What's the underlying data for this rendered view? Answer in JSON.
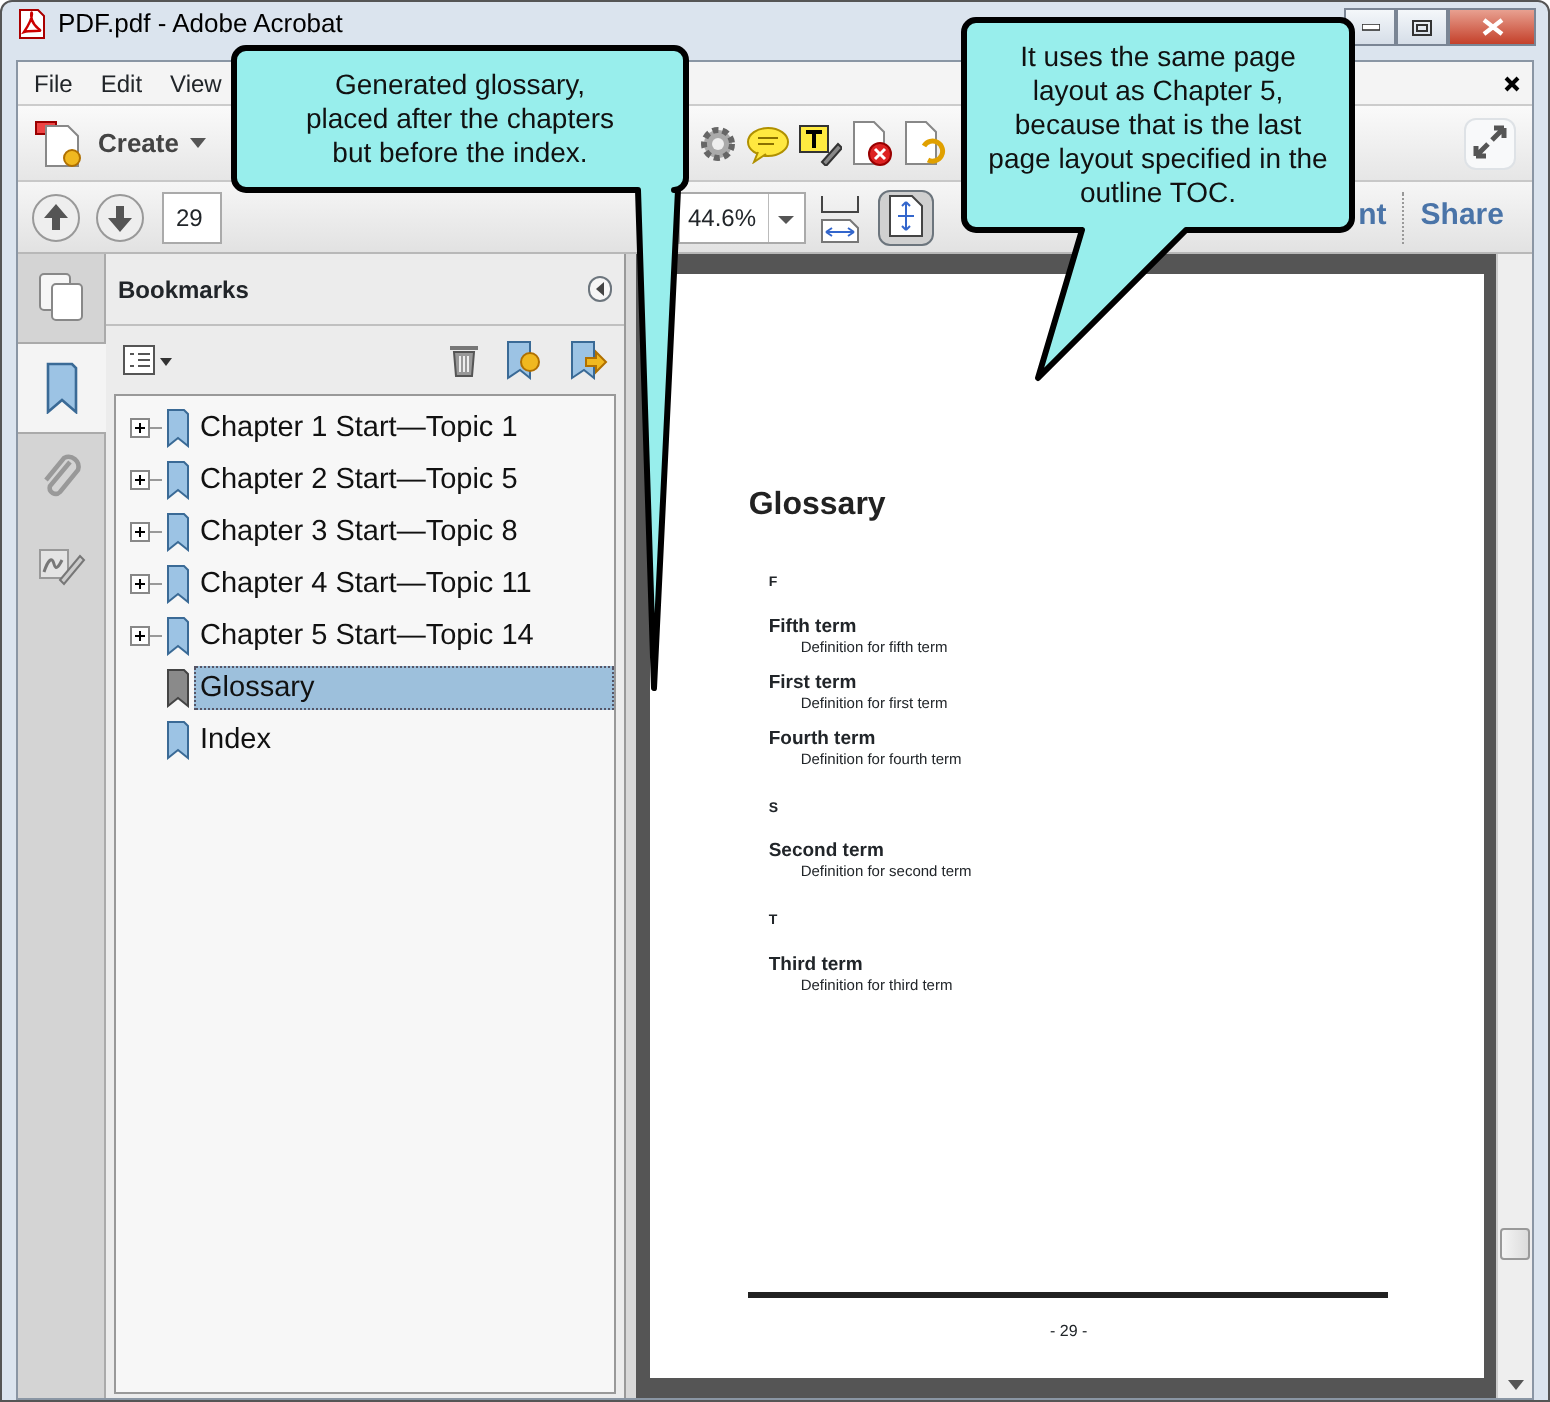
{
  "window": {
    "title": "PDF.pdf - Adobe Acrobat"
  },
  "menu": [
    "File",
    "Edit",
    "View"
  ],
  "toolbar": {
    "create": "Create",
    "tasks": [
      {
        "label": "nt"
      },
      {
        "label": "Share"
      }
    ]
  },
  "navigation": {
    "page": "29",
    "zoom": "44.6%"
  },
  "bookmarks": {
    "title": "Bookmarks",
    "items": [
      {
        "label": "Chapter 1 Start—Topic 1",
        "expandable": true,
        "selected": false
      },
      {
        "label": "Chapter 2 Start—Topic 5",
        "expandable": true,
        "selected": false
      },
      {
        "label": "Chapter 3 Start—Topic 8",
        "expandable": true,
        "selected": false
      },
      {
        "label": "Chapter 4 Start—Topic 11",
        "expandable": true,
        "selected": false
      },
      {
        "label": "Chapter 5 Start—Topic 14",
        "expandable": true,
        "selected": false
      },
      {
        "label": "Glossary",
        "expandable": false,
        "selected": true
      },
      {
        "label": "Index",
        "expandable": false,
        "selected": false
      }
    ]
  },
  "page": {
    "heading": "Glossary",
    "sections": [
      {
        "letter": "F",
        "entries": [
          {
            "term": "Fifth term",
            "definition": "Definition for fifth term"
          },
          {
            "term": "First term",
            "definition": "Definition for first term"
          },
          {
            "term": "Fourth term",
            "definition": "Definition for fourth term"
          }
        ]
      },
      {
        "letter": "S",
        "entries": [
          {
            "term": "Second term",
            "definition": "Definition for second term"
          }
        ]
      },
      {
        "letter": "T",
        "entries": [
          {
            "term": "Third term",
            "definition": "Definition for third term"
          }
        ]
      }
    ],
    "footer": "- 29 -"
  },
  "callouts": [
    {
      "text": "Generated glossary, placed after the chapters but before the index."
    },
    {
      "text": "It uses the same page layout as Chapter 5, because that is the last page layout specified in the outline TOC."
    }
  ]
}
